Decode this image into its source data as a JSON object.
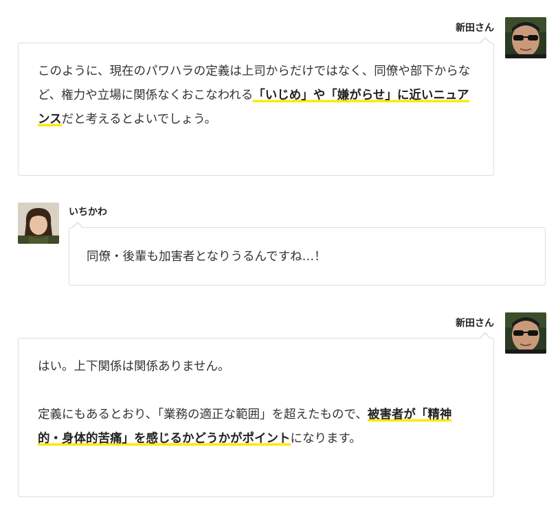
{
  "messages": [
    {
      "speaker": "新田さん",
      "avatar_icon": "man-with-sunglasses-avatar",
      "side": "right",
      "paragraphs": [
        {
          "segments": [
            {
              "text": "このように、現在のパワハラの定義は上司からだけではなく、同僚や部下からなど、権力や立場に関係なくおこなわれる",
              "highlight": false
            },
            {
              "text": "「いじめ」や「嫌がらせ」に近いニュアンス",
              "highlight": true
            },
            {
              "text": "だと考えるとよいでしょう。",
              "highlight": false
            }
          ]
        }
      ]
    },
    {
      "speaker": "いちかわ",
      "avatar_icon": "woman-avatar",
      "side": "left",
      "paragraphs": [
        {
          "segments": [
            {
              "text": "同僚・後輩も加害者となりうるんですね…！",
              "highlight": false
            }
          ]
        }
      ]
    },
    {
      "speaker": "新田さん",
      "avatar_icon": "man-with-sunglasses-avatar",
      "side": "right",
      "paragraphs": [
        {
          "segments": [
            {
              "text": "はい。上下関係は関係ありません。",
              "highlight": false
            }
          ]
        },
        {
          "segments": [
            {
              "text": "定義にもあるとおり、「業務の適正な範囲」を超えたもので、",
              "highlight": false
            },
            {
              "text": "被害者が「精神的・身体的苦痛」を感じるかどうかがポイント",
              "highlight": true
            },
            {
              "text": "になります。",
              "highlight": false
            }
          ]
        }
      ]
    }
  ],
  "colors": {
    "highlight": "#ffe800",
    "bubble_border": "#dddddd",
    "text": "#333333"
  }
}
